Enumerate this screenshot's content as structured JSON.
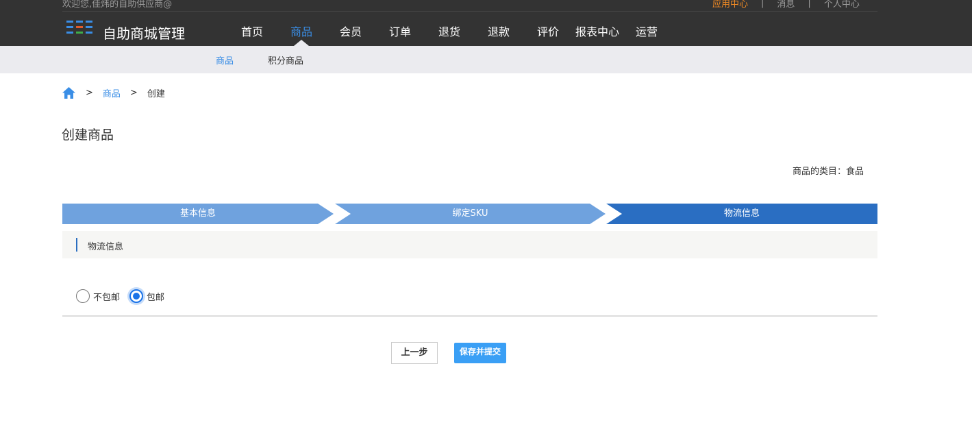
{
  "header": {
    "welcome": "欢迎您,佳炜的自助供应商@",
    "top_links": [
      {
        "label": "应用中心",
        "accent": true
      },
      {
        "label": "消息",
        "accent": false
      },
      {
        "label": "个人中心",
        "accent": false
      }
    ],
    "separator": "|",
    "brand": "自助商城管理",
    "logo_icon": "grid-icon",
    "nav": [
      {
        "label": "首页",
        "active": false
      },
      {
        "label": "商品",
        "active": true
      },
      {
        "label": "会员",
        "active": false
      },
      {
        "label": "订单",
        "active": false
      },
      {
        "label": "退货",
        "active": false
      },
      {
        "label": "退款",
        "active": false
      },
      {
        "label": "评价",
        "active": false
      },
      {
        "label": "报表中心",
        "active": false
      },
      {
        "label": "运营",
        "active": false
      }
    ]
  },
  "subnav": [
    {
      "label": "商品",
      "active": true
    },
    {
      "label": "积分商品",
      "active": false
    }
  ],
  "breadcrumb": {
    "home_icon": "home-icon",
    "separator": ">",
    "link": "商品",
    "current": "创建"
  },
  "page_title": "创建商品",
  "category": "商品的类目：食品",
  "steps": [
    {
      "label": "基本信息",
      "active": false
    },
    {
      "label": "绑定SKU",
      "active": false
    },
    {
      "label": "物流信息",
      "active": true
    }
  ],
  "section_title": "物流信息",
  "shipping": {
    "options": [
      {
        "label": "不包邮",
        "checked": false
      },
      {
        "label": "包邮",
        "checked": true
      }
    ]
  },
  "buttons": {
    "prev": "上一步",
    "save": "保存并提交"
  },
  "colors": {
    "topbar": "#333333",
    "accent_orange": "#f08a24",
    "link_blue": "#3a8ee6",
    "step_inactive": "#6fa2de",
    "step_active": "#2a6ec2",
    "primary_button": "#3a9ff5"
  }
}
